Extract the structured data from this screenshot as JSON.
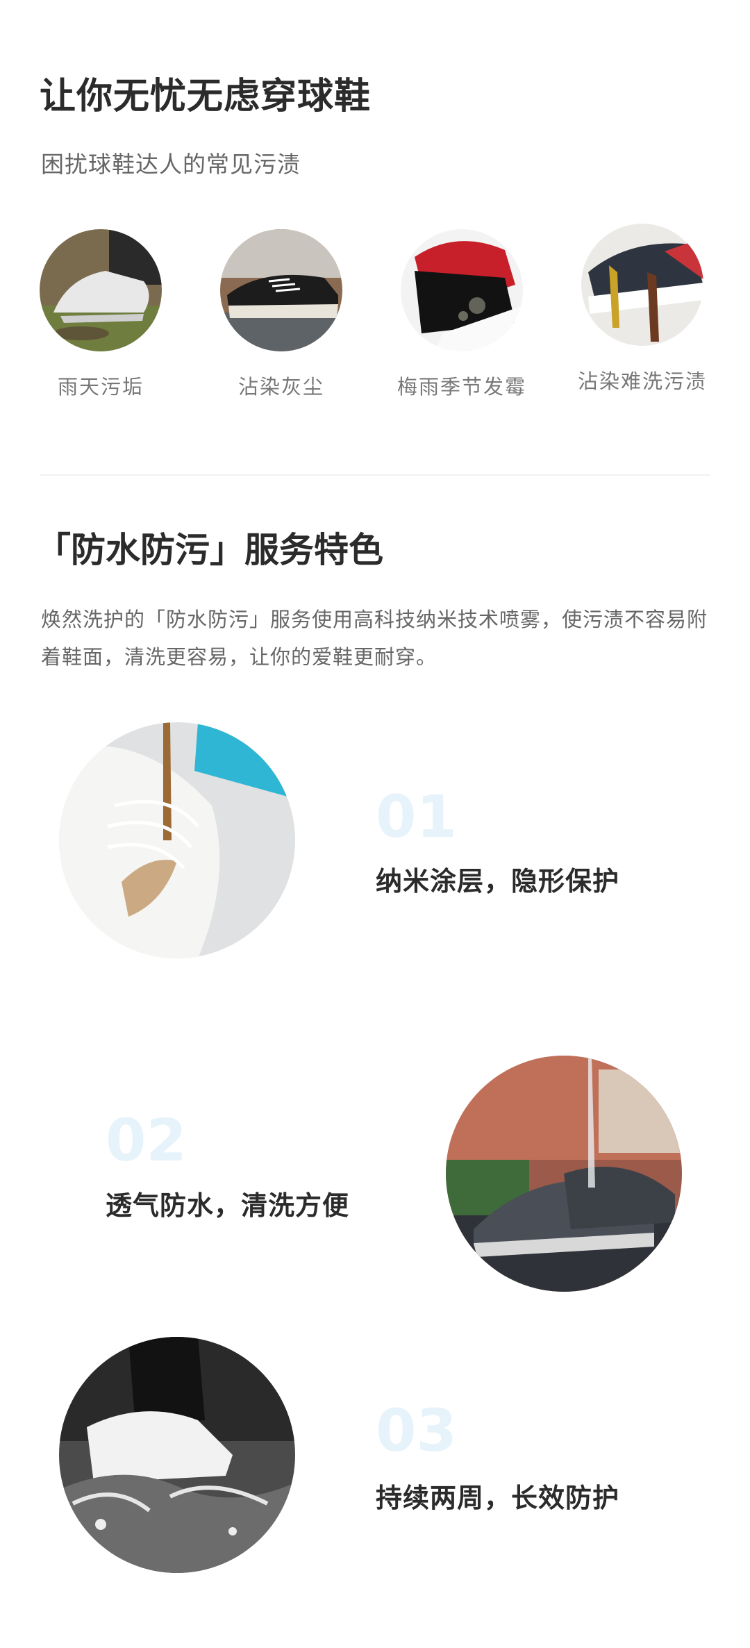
{
  "header": {
    "title": "让你无忧无虑穿球鞋",
    "subtitle": "困扰球鞋达人的常见污渍"
  },
  "stains": [
    {
      "label": "雨天污垢",
      "icon": "muddy-sneaker-photo"
    },
    {
      "label": "沾染灰尘",
      "icon": "dusty-sneaker-photo"
    },
    {
      "label": "梅雨季节发霉",
      "icon": "moldy-sneaker-photo"
    },
    {
      "label": "沾染难洗污渍",
      "icon": "stained-sneaker-photo"
    }
  ],
  "service": {
    "title": "「防水防污」服务特色",
    "description": "焕然洗护的「防水防污」服务使用高科技纳米技术喷雾，使污渍不容易附着鞋面，清洗更容易，让你的爱鞋更耐穿。"
  },
  "features": [
    {
      "number": "01",
      "title": "纳米涂层，隐形保护",
      "icon": "coffee-spill-sneaker-photo"
    },
    {
      "number": "02",
      "title": "透气防水，清洗方便",
      "icon": "water-splash-sneaker-photo"
    },
    {
      "number": "03",
      "title": "持续两周，长效防护",
      "icon": "puddle-splash-sneaker-photo"
    }
  ],
  "colors": {
    "heading": "#2b2b2b",
    "body": "#666666",
    "number_accent": "#e6f3fb",
    "divider": "#f1f1f1"
  }
}
